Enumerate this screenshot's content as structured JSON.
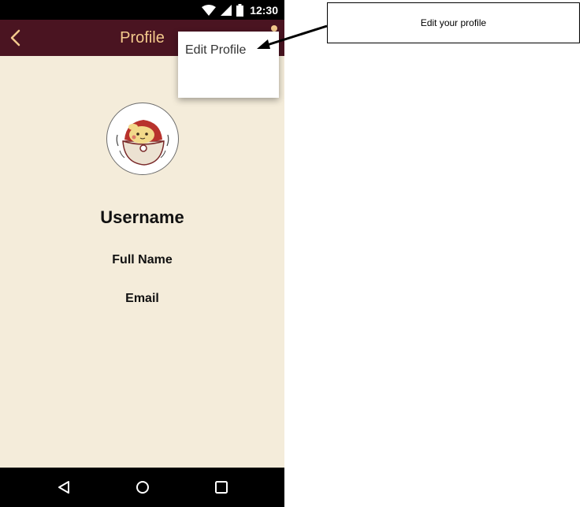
{
  "status_bar": {
    "time": "12:30",
    "icons": [
      "wifi-icon",
      "signal-icon",
      "battery-icon"
    ]
  },
  "app_bar": {
    "title": "Profile",
    "back_icon": "chevron-left-icon",
    "menu_icon": "overflow-menu-icon"
  },
  "menu": {
    "items": [
      {
        "label": "Edit Profile"
      }
    ]
  },
  "profile": {
    "avatar_icon": "pokeball-pokemon-avatar",
    "username": "Username",
    "full_name": "Full Name",
    "email": "Email"
  },
  "nav_bar": {
    "buttons": [
      "back-triangle-icon",
      "home-circle-icon",
      "recents-square-icon"
    ]
  },
  "annotation": {
    "callout_text": "Edit your profile"
  },
  "colors": {
    "app_bar": "#4a1421",
    "title_accent": "#f3c98c",
    "background": "#f4ecda",
    "system_bars": "#000000"
  }
}
